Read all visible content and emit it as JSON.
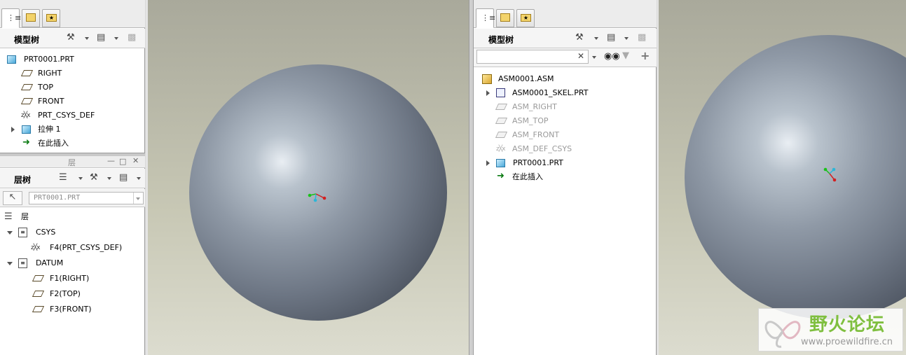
{
  "left_panel": {
    "model_tree": {
      "title": "模型树",
      "items": [
        {
          "label": "PRT0001.PRT"
        },
        {
          "label": "RIGHT"
        },
        {
          "label": "TOP"
        },
        {
          "label": "FRONT"
        },
        {
          "label": "PRT_CSYS_DEF"
        },
        {
          "label": "拉伸 1"
        },
        {
          "label": "在此插入"
        }
      ]
    },
    "layer_tree": {
      "header_title": "层",
      "title": "层树",
      "select_value": "PRT0001.PRT",
      "items": [
        {
          "label": "层"
        },
        {
          "label": "CSYS"
        },
        {
          "label": "F4(PRT_CSYS_DEF)"
        },
        {
          "label": "DATUM"
        },
        {
          "label": "F1(RIGHT)"
        },
        {
          "label": "F2(TOP)"
        },
        {
          "label": "F3(FRONT)"
        }
      ]
    }
  },
  "right_panel": {
    "model_tree": {
      "title": "模型树",
      "search_value": "",
      "items": [
        {
          "label": "ASM0001.ASM"
        },
        {
          "label": "ASM0001_SKEL.PRT"
        },
        {
          "label": "ASM_RIGHT"
        },
        {
          "label": "ASM_TOP"
        },
        {
          "label": "ASM_FRONT"
        },
        {
          "label": "ASM_DEF_CSYS"
        },
        {
          "label": "PRT0001.PRT"
        },
        {
          "label": "在此插入"
        }
      ]
    }
  },
  "watermark": {
    "title": "野火论坛",
    "url": "www.proewildfire.cn"
  },
  "colors": {
    "accent_green": "#0a7a12",
    "part_blue": "#49a8d8",
    "watermark_green": "#7fbf3f"
  }
}
